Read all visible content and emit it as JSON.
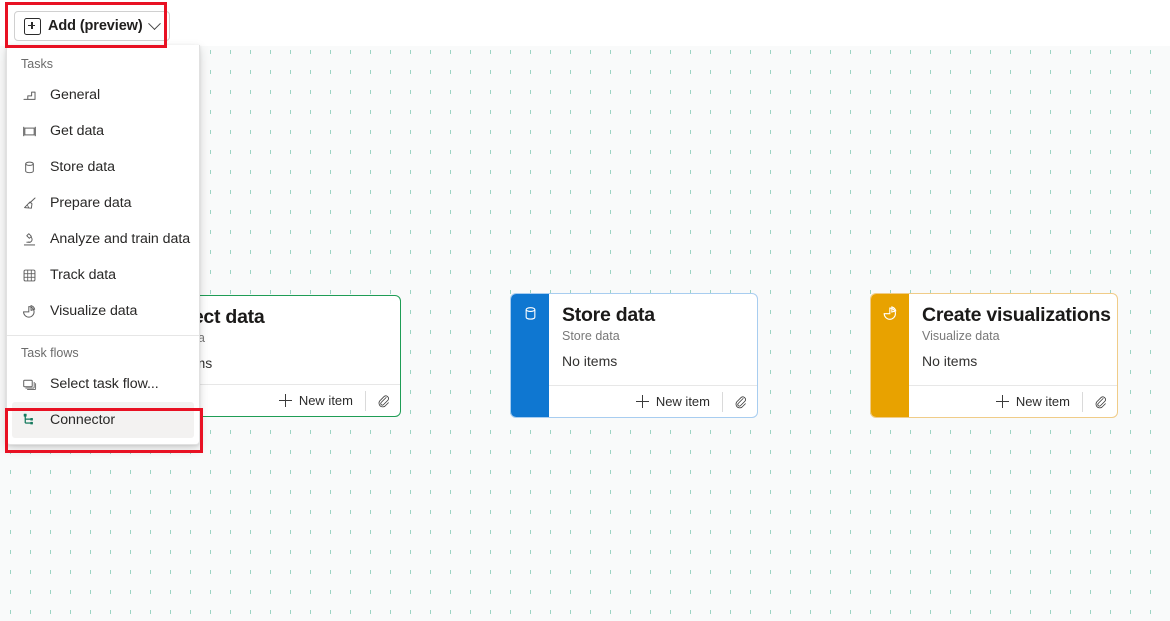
{
  "toolbar": {
    "add_button_label": "Add (preview)",
    "add_icon": "square-plus-icon",
    "chevron_icon": "chevron-down-icon"
  },
  "menu": {
    "sections": [
      {
        "header": "Tasks",
        "items": [
          {
            "label": "General",
            "icon": "stairs-icon"
          },
          {
            "label": "Get data",
            "icon": "pipeline-icon"
          },
          {
            "label": "Store data",
            "icon": "database-icon"
          },
          {
            "label": "Prepare data",
            "icon": "broom-icon"
          },
          {
            "label": "Analyze and train data",
            "icon": "microscope-icon"
          },
          {
            "label": "Track data",
            "icon": "grid-table-icon"
          },
          {
            "label": "Visualize data",
            "icon": "pie-chart-icon"
          }
        ]
      },
      {
        "header": "Task flows",
        "items": [
          {
            "label": "Select task flow...",
            "icon": "stacked-windows-icon"
          },
          {
            "label": "Connector",
            "icon": "connector-node-icon"
          }
        ]
      }
    ]
  },
  "cards": [
    {
      "title": "Collect data",
      "subtitle": "Get data",
      "items_text": "No items",
      "new_item_label": "New item",
      "accent_color": "#ffffff",
      "border_color": "#1f9d55",
      "icon": "pipeline-icon",
      "attach_icon": "paperclip-icon"
    },
    {
      "title": "Store data",
      "subtitle": "Store data",
      "items_text": "No items",
      "new_item_label": "New item",
      "accent_color": "#0f77d1",
      "border_color": "#a8cdf0",
      "icon": "database-icon",
      "attach_icon": "paperclip-icon"
    },
    {
      "title": "Create visualizations",
      "subtitle": "Visualize data",
      "items_text": "No items",
      "new_item_label": "New item",
      "accent_color": "#e8a200",
      "border_color": "#f0cc88",
      "icon": "pie-chart-icon",
      "attach_icon": "paperclip-icon"
    }
  ],
  "annotations": {
    "highlight_color": "#e81123",
    "boxes": [
      "add-button-highlight",
      "connector-menu-item-highlight"
    ]
  }
}
